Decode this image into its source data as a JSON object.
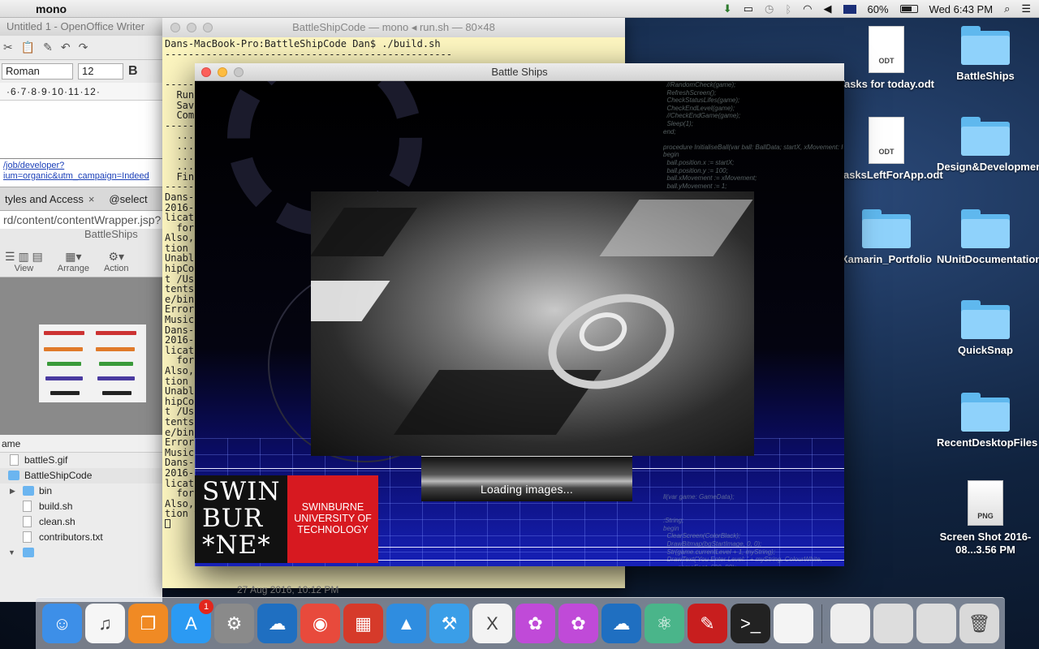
{
  "menubar": {
    "app_name": "mono",
    "battery_percent": "60%",
    "clock": "Wed 6:43 PM"
  },
  "writer": {
    "title": "Untitled 1 - OpenOffice Writer",
    "font_name": "Roman",
    "font_size": "12",
    "bold_label": "B",
    "ruler": "·6·7·8·9·10·11·12·",
    "link_line1": "/job/developer?",
    "link_line2": "ium=organic&utm_campaign=Indeed",
    "tab1": "tyles and Access",
    "tab2": "@select",
    "url": "rd/content/contentWrapper.jsp?",
    "finder_title": "BattleShips",
    "view_label": "View",
    "arrange_label": "Arrange",
    "action_label": "Action",
    "col_name": "ame",
    "files": [
      {
        "name": "battleS.gif",
        "type": "doc"
      },
      {
        "name": "BattleShipCode",
        "type": "folder"
      },
      {
        "name": "bin",
        "type": "folder"
      },
      {
        "name": "build.sh",
        "type": "doc"
      },
      {
        "name": "clean.sh",
        "type": "doc"
      },
      {
        "name": "contributors.txt",
        "type": "doc"
      },
      {
        "name": "lib",
        "type": "folder"
      }
    ]
  },
  "terminal": {
    "title": "BattleShipCode — mono ◂ run.sh — 80×48",
    "lines": [
      "Dans-MacBook-Pro:BattleShipCode Dan$ ./build.sh",
      "-------------------------------------------------",
      "",
      "",
      "-----",
      "  Run",
      "  Sav",
      "  Com",
      "-----",
      "  ...",
      "  ...",
      "  ...",
      "  ...",
      "  Fin",
      "-----",
      "Dans-",
      "2016-",
      "licat",
      "  for",
      "Also,",
      "tion",
      "Unabl",
      "hipCo",
      "t /Us",
      "tents",
      "e/bin",
      "Error",
      "Music",
      "Dans-",
      "2016-",
      "licat",
      "  for",
      "Also,",
      "tion",
      "Unabl",
      "hipCo",
      "t /Us",
      "tents",
      "e/bin",
      "Error",
      "Music",
      "Dans-",
      "2016-",
      "licat",
      "  for",
      "Also,",
      "tion to the API's in AudioComponent.n."
    ]
  },
  "game": {
    "title": "Battle Ships",
    "loading_text": "Loading images...",
    "logo_black": [
      "SWIN",
      "BUR",
      "*NE*"
    ],
    "logo_red": [
      "SWINBURNE",
      "UNIVERSITY OF",
      "TECHNOLOGY"
    ],
    "code_ghost": "  //RandomCheck(game);\n  RefreshScreen();\n  CheckStatusLifes(game);\n  CheckEndLevel(game);\n  //CheckEndGame(game);\n  Sleep(1);\nend;\n\nprocedure InitialiseBall(var ball: BallData; startX, xMovement: I\nbegin\n  ball.position.x := startX;\n  ball.position.y := 100;\n  ball.xMovement := xMovement;\n  ball.yMovement := 1;\n\n\n\n\ngame: GameData);\n\n\ntrue);\n\n\n\n\n\n\name: GameData);\n\nthen\n\n\n\n\n\n\nthen game.myExit:=true;\n\n\n\n\n\n\ngame: GameData);\n\n\n0);\n\n\n\n\n\nll(var game: GameData);\n\n\n:String;\nbegin\n  ClearScreen(ColorBlack);\n  DrawBitmap(bgStartImage, 0, 0);\n  Str(game.currentLevel + 1, myString);\n  DrawText('You Enter Level: ' + myString, ColourWhite,\n        gameFont, 600, 80);\n  Str(game.myLifes, myString2);\n  DrawText('Your Lifes: ' + myString2, ColourWhite,\n        gameFont, 600, 100);\n  Str(game.points, myString3);\n  DrawText('Your Points: ' + myString3, ColourWhite,\n        gameFont, 600, 120);\n  GameContinue(game);\nend;"
  },
  "desktop": {
    "icons": [
      {
        "label": "Tasks for today.odt",
        "kind": "doc",
        "badge": "ODT"
      },
      {
        "label": "BattleShips",
        "kind": "folder"
      },
      {
        "label": "TasksLeftForApp.odt",
        "kind": "doc",
        "badge": "ODT"
      },
      {
        "label": "Design&Development",
        "kind": "folder"
      },
      {
        "label": "Xamarin_Portfolio",
        "kind": "folder"
      },
      {
        "label": "NUnitDocumentation",
        "kind": "folder"
      },
      {
        "label": "QuickSnap",
        "kind": "folder"
      },
      {
        "label": "RecentDesktopFiles",
        "kind": "folder"
      },
      {
        "label": "Screen Shot 2016-08...3.56 PM",
        "kind": "png",
        "badge": "PNG"
      }
    ],
    "bg_date": "27 Aug 2016, 10:12 PM"
  },
  "dock": {
    "items": [
      {
        "name": "finder-icon",
        "color": "#3d8fe8",
        "glyph": "☺"
      },
      {
        "name": "itunes-icon",
        "color": "#f6f6f6",
        "glyph": "♫"
      },
      {
        "name": "ibooks-icon",
        "color": "#f08a24",
        "glyph": "❐"
      },
      {
        "name": "app-store-icon",
        "color": "#2b9af3",
        "glyph": "A",
        "badge": "1"
      },
      {
        "name": "system-preferences-icon",
        "color": "#8a8a8a",
        "glyph": "⚙"
      },
      {
        "name": "openoffice-icon",
        "color": "#1f6fc1",
        "glyph": "☁"
      },
      {
        "name": "chrome-icon",
        "color": "#e84a3c",
        "glyph": "◉"
      },
      {
        "name": "office-tiles-icon",
        "color": "#d63a2a",
        "glyph": "▦"
      },
      {
        "name": "xcode-simulator-icon",
        "color": "#2f8de0",
        "glyph": "▲"
      },
      {
        "name": "xcode-icon",
        "color": "#3a9ee8",
        "glyph": "⚒"
      },
      {
        "name": "xamarin-icon",
        "color": "#f3f3f3",
        "glyph": "X"
      },
      {
        "name": "flower-app-icon",
        "color": "#c04ad8",
        "glyph": "✿"
      },
      {
        "name": "flower-app-2-icon",
        "color": "#c04ad8",
        "glyph": "✿"
      },
      {
        "name": "openoffice-2-icon",
        "color": "#1f6fc1",
        "glyph": "☁"
      },
      {
        "name": "atom-icon",
        "color": "#4ab58a",
        "glyph": "⚛"
      },
      {
        "name": "acrobat-icon",
        "color": "#c81e1e",
        "glyph": "✎"
      },
      {
        "name": "terminal-icon",
        "color": "#222222",
        "glyph": ">_"
      },
      {
        "name": "blank-document-icon",
        "color": "#f4f4f4",
        "glyph": ""
      }
    ],
    "right_items": [
      {
        "name": "downloads-stack-icon",
        "color": "#eeeeee",
        "glyph": ""
      },
      {
        "name": "window-thumbnail-1-icon",
        "color": "#dddddd",
        "glyph": ""
      },
      {
        "name": "window-thumbnail-2-icon",
        "color": "#dddddd",
        "glyph": ""
      },
      {
        "name": "trash-icon",
        "color": "#d9d9d9",
        "glyph": "🗑"
      }
    ]
  }
}
